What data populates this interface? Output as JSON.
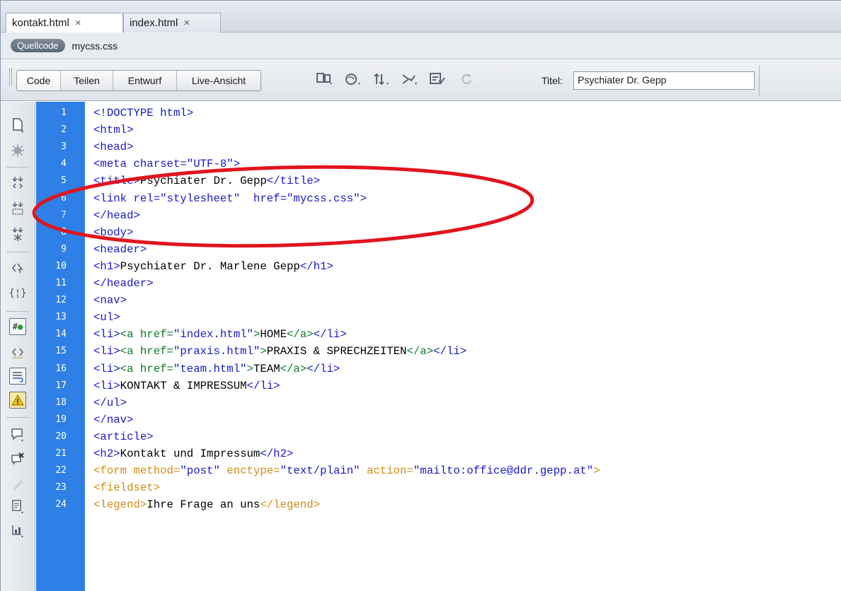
{
  "tabs": [
    {
      "label": "kontakt.html",
      "close": "×",
      "active": true
    },
    {
      "label": "index.html",
      "close": "×",
      "active": false
    }
  ],
  "related_files": {
    "source_label": "Quellcode",
    "file": "mycss.css"
  },
  "toolbar": {
    "views": [
      "Code",
      "Teilen",
      "Entwurf",
      "Live-Ansicht"
    ],
    "title_label": "Titel:",
    "title_value": "Psychiater Dr. Gepp"
  },
  "line_numbers": [
    "1",
    "2",
    "3",
    "4",
    "5",
    "6",
    "7",
    "8",
    "9",
    "10",
    "11",
    "12",
    "13",
    "14",
    "15",
    "16",
    "17",
    "18",
    "19",
    "20",
    "21",
    "22",
    "23",
    "24"
  ],
  "code_lines": [
    [
      {
        "c": "tag",
        "t": "<!DOCTYPE html>"
      }
    ],
    [
      {
        "c": "tag",
        "t": "<html>"
      }
    ],
    [
      {
        "c": "tag",
        "t": "<head>"
      }
    ],
    [
      {
        "c": "tag",
        "t": "<meta charset="
      },
      {
        "c": "val",
        "t": "\"UTF-8\""
      },
      {
        "c": "tag",
        "t": ">"
      }
    ],
    [
      {
        "c": "tag",
        "t": "<title>"
      },
      {
        "c": "txt",
        "t": "Psychiater Dr. Gepp"
      },
      {
        "c": "tag",
        "t": "</title>"
      }
    ],
    [
      {
        "c": "tag",
        "t": "<link rel="
      },
      {
        "c": "val",
        "t": "\"stylesheet\""
      },
      {
        "c": "tag",
        "t": "  href="
      },
      {
        "c": "val",
        "t": "\"mycss.css\""
      },
      {
        "c": "tag",
        "t": ">"
      }
    ],
    [
      {
        "c": "tag",
        "t": "</head>"
      }
    ],
    [
      {
        "c": "tag",
        "t": "<body>"
      }
    ],
    [
      {
        "c": "tag",
        "t": "<header>"
      }
    ],
    [
      {
        "c": "tag",
        "t": "<h1>"
      },
      {
        "c": "txt",
        "t": "Psychiater Dr. Marlene Gepp"
      },
      {
        "c": "tag",
        "t": "</h1>"
      }
    ],
    [
      {
        "c": "tag",
        "t": "</header>"
      }
    ],
    [
      {
        "c": "tag",
        "t": "<nav>"
      }
    ],
    [
      {
        "c": "tag",
        "t": "<ul>"
      }
    ],
    [
      {
        "c": "tag",
        "t": "<li>"
      },
      {
        "c": "atag",
        "t": "<a href="
      },
      {
        "c": "val",
        "t": "\"index.html\""
      },
      {
        "c": "atag",
        "t": ">"
      },
      {
        "c": "txt",
        "t": "HOME"
      },
      {
        "c": "atag",
        "t": "</a>"
      },
      {
        "c": "tag",
        "t": "</li>"
      }
    ],
    [
      {
        "c": "tag",
        "t": "<li>"
      },
      {
        "c": "atag",
        "t": "<a href="
      },
      {
        "c": "val",
        "t": "\"praxis.html\""
      },
      {
        "c": "atag",
        "t": ">"
      },
      {
        "c": "txt",
        "t": "PRAXIS & SPRECHZEITEN"
      },
      {
        "c": "atag",
        "t": "</a>"
      },
      {
        "c": "tag",
        "t": "</li>"
      }
    ],
    [
      {
        "c": "tag",
        "t": "<li>"
      },
      {
        "c": "atag",
        "t": "<a href="
      },
      {
        "c": "val",
        "t": "\"team.html\""
      },
      {
        "c": "atag",
        "t": ">"
      },
      {
        "c": "txt",
        "t": "TEAM"
      },
      {
        "c": "atag",
        "t": "</a>"
      },
      {
        "c": "tag",
        "t": "</li>"
      }
    ],
    [
      {
        "c": "tag",
        "t": "<li>"
      },
      {
        "c": "txt",
        "t": "KONTAKT & IMPRESSUM"
      },
      {
        "c": "tag",
        "t": "</li>"
      }
    ],
    [
      {
        "c": "tag",
        "t": "</ul>"
      }
    ],
    [
      {
        "c": "tag",
        "t": "</nav>"
      }
    ],
    [
      {
        "c": "tag",
        "t": "<article>"
      }
    ],
    [
      {
        "c": "tag",
        "t": "<h2>"
      },
      {
        "c": "txt",
        "t": "Kontakt und Impressum"
      },
      {
        "c": "tag",
        "t": "</h2>"
      }
    ],
    [
      {
        "c": "ftag",
        "t": "<form method="
      },
      {
        "c": "fval",
        "t": "\"post\""
      },
      {
        "c": "ftag",
        "t": " enctype="
      },
      {
        "c": "fval",
        "t": "\"text/plain\""
      },
      {
        "c": "ftag",
        "t": " action="
      },
      {
        "c": "fval",
        "t": "\"mailto:office@ddr.gepp.at\""
      },
      {
        "c": "ftag",
        "t": ">"
      }
    ],
    [
      {
        "c": "ftag",
        "t": "<fieldset>"
      }
    ],
    [
      {
        "c": "ftag",
        "t": "<legend>"
      },
      {
        "c": "txt",
        "t": "Ihre Frage an uns"
      },
      {
        "c": "ftag",
        "t": "</legend>"
      }
    ]
  ],
  "colors": {
    "gutter": "#2f80e6",
    "tag": "#1a1ac4",
    "form_tag": "#d28b14",
    "anchor_tag": "#0b7a2c",
    "annotation": "#e0141e"
  }
}
